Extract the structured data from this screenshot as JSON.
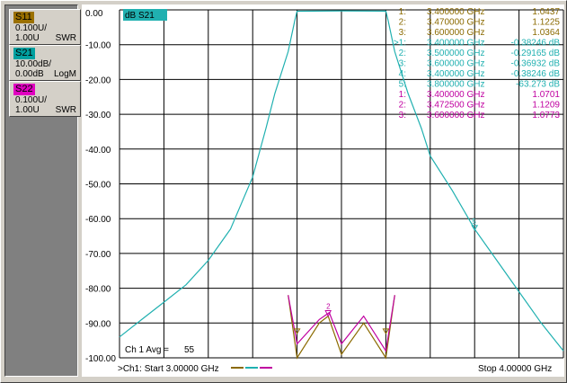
{
  "traces": [
    {
      "name": "S11",
      "scale": "0.100U/",
      "ref": "1.00U",
      "format": "SWR",
      "color": "#9b7000"
    },
    {
      "name": "S21",
      "scale": "10.00dB/",
      "ref": "0.00dB",
      "format": "LogM",
      "color": "#00a0a0"
    },
    {
      "name": "S22",
      "scale": "0.100U/",
      "ref": "1.00U",
      "format": "SWR",
      "color": "#e000c0"
    }
  ],
  "colors": {
    "s11": "#8b6a00",
    "s21": "#20b0b0",
    "s22": "#c000a0",
    "grid": "#000000"
  },
  "active_trace_label": "dB S21",
  "y_ticks": [
    "0.00",
    "-10.00",
    "-20.00",
    "-30.00",
    "-40.00",
    "-50.00",
    "-60.00",
    "-70.00",
    "-80.00",
    "-90.00",
    "-100.00"
  ],
  "markers": {
    "s11": [
      {
        "idx": "1:",
        "freq": "3.400000 GHz",
        "val": "1.0437"
      },
      {
        "idx": "2:",
        "freq": "3.470000 GHz",
        "val": "1.1225"
      },
      {
        "idx": "3:",
        "freq": "3.600000 GHz",
        "val": "1.0364"
      }
    ],
    "s21": [
      {
        "idx": ">1:",
        "freq": "3.400000 GHz",
        "val": "-0.38246 dB"
      },
      {
        "idx": "2:",
        "freq": "3.500000 GHz",
        "val": "-0.29165 dB"
      },
      {
        "idx": "3:",
        "freq": "3.600000 GHz",
        "val": "-0.36932 dB"
      },
      {
        "idx": "4:",
        "freq": "3.400000 GHz",
        "val": "-0.38246 dB"
      },
      {
        "idx": "5:",
        "freq": "3.800000 GHz",
        "val": "-63.273 dB"
      }
    ],
    "s22": [
      {
        "idx": "1:",
        "freq": "3.400000 GHz",
        "val": "1.0701"
      },
      {
        "idx": "2:",
        "freq": "3.472500 GHz",
        "val": "1.1209"
      },
      {
        "idx": "3:",
        "freq": "3.600000 GHz",
        "val": "1.0773"
      }
    ]
  },
  "avg_label": "Ch 1 Avg =",
  "avg_value": "55",
  "start_label": ">Ch1: Start  3.00000 GHz",
  "stop_label": "Stop  4.00000 GHz",
  "plot_marker_label": "2",
  "s21_marker_label": "5",
  "chart_data": {
    "type": "line",
    "x_range_ghz": [
      3.0,
      4.0
    ],
    "ylim": [
      -100,
      0
    ],
    "grid": true,
    "series": [
      {
        "name": "S21",
        "x": [
          3.0,
          3.05,
          3.1,
          3.15,
          3.2,
          3.25,
          3.3,
          3.33,
          3.35,
          3.38,
          3.395,
          3.4,
          3.5,
          3.6,
          3.605,
          3.62,
          3.65,
          3.68,
          3.7,
          3.75,
          3.8,
          3.85,
          3.9,
          3.95,
          4.0
        ],
        "y": [
          -94,
          -89,
          -84,
          -79,
          -72,
          -63,
          -48,
          -34,
          -24,
          -12,
          -3,
          -0.38,
          -0.29,
          -0.37,
          -3,
          -12,
          -24,
          -34,
          -42,
          -52,
          -63,
          -72,
          -81,
          -90,
          -98
        ]
      },
      {
        "name": "S11",
        "x": [
          3.38,
          3.4,
          3.45,
          3.47,
          3.5,
          3.55,
          3.6,
          3.62
        ],
        "y": [
          -82,
          -100,
          -90,
          -88,
          -99,
          -90,
          -100,
          -82
        ]
      },
      {
        "name": "S22",
        "x": [
          3.38,
          3.4,
          3.45,
          3.4725,
          3.5,
          3.55,
          3.6,
          3.62
        ],
        "y": [
          -82,
          -96,
          -89,
          -87,
          -96,
          -88,
          -98,
          -82
        ]
      }
    ]
  }
}
